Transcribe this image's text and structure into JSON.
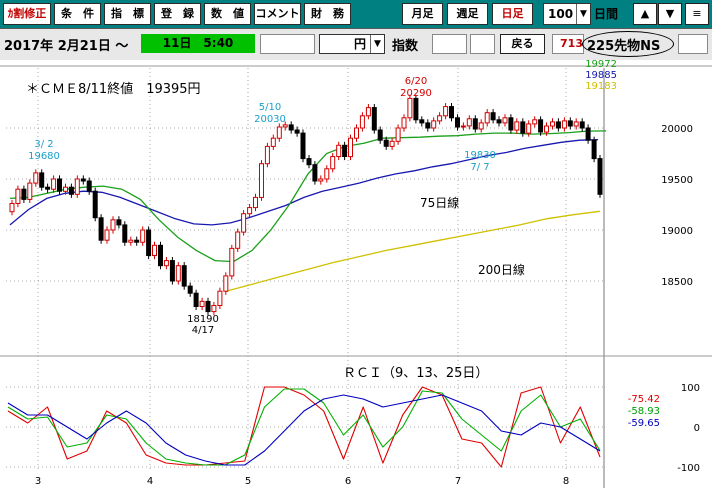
{
  "toolbar": {
    "buttons": [
      "ｶ割修正",
      "条　件",
      "指　標",
      "登　録",
      "数　値",
      "コメント",
      "財　務"
    ],
    "period_buttons": [
      "月足",
      "週足",
      "日足"
    ],
    "count_value": "100",
    "period_label": "日間",
    "up_icon": "▲",
    "down_icon": "▼",
    "menu_icon": "≡"
  },
  "filter": {
    "date": "2017年 2月21日 〜",
    "time": "11日　5:40",
    "currency": "円",
    "index_label": "指数",
    "back_button": "戻る",
    "code": "713",
    "instrument": "225先物NS"
  },
  "colors": {
    "accent_bar": "#008080",
    "time_bg": "#00c000",
    "candle_up": "#d40000",
    "candle_down": "#000000",
    "ma_short": "#1aa01a",
    "ma_75": "#1818b0",
    "ma_200": "#d0c000",
    "rci_9": "#e00000",
    "rci_13": "#00b000",
    "rci_25": "#0000c0"
  },
  "chart_data": {
    "type": "candlestick",
    "title": "＊ＣＭＥ8/11終値　19395円",
    "y_ticks": [
      20000,
      19500,
      19000,
      18500
    ],
    "ylim": [
      18180,
      20380
    ],
    "x_ticks": [
      "3",
      "4",
      "5",
      "6",
      "7",
      "8"
    ],
    "ma_values": [
      {
        "name": "short",
        "value": "19972"
      },
      {
        "name": "75",
        "value": "19885"
      },
      {
        "name": "200",
        "value": "19183"
      }
    ],
    "ma_labels": {
      "ma75": "75日線",
      "ma200": "200日線"
    },
    "annotations": [
      {
        "date": "3/ 2",
        "value": "19680",
        "pos": "above",
        "color": "cyan"
      },
      {
        "date": "5/10",
        "value": "20030",
        "pos": "above",
        "color": "cyan"
      },
      {
        "date": "6/20",
        "value": "20290",
        "pos": "above",
        "color": "red"
      },
      {
        "date": "7/ 7",
        "value": "19830",
        "pos": "below",
        "color": "cyan"
      },
      {
        "date": "4/17",
        "value": "18190",
        "pos": "below",
        "color": "black"
      }
    ],
    "series": [
      {
        "name": "short",
        "values": [
          19310,
          19320,
          19360,
          19400,
          19420,
          19430,
          19400,
          19300,
          19100,
          18930,
          18800,
          18700,
          18690,
          18800,
          19000,
          19250,
          19550,
          19750,
          19820,
          19850,
          19900,
          19905,
          19910,
          19920,
          19925,
          19940,
          19950,
          19950,
          19940,
          19945,
          19955,
          19970,
          19972
        ]
      },
      {
        "name": "75",
        "values": [
          19050,
          19200,
          19310,
          19360,
          19380,
          19370,
          19320,
          19250,
          19180,
          19110,
          19060,
          19050,
          19070,
          19120,
          19180,
          19240,
          19320,
          19380,
          19420,
          19460,
          19510,
          19550,
          19580,
          19620,
          19650,
          19690,
          19730,
          19760,
          19800,
          19830,
          19860,
          19880,
          19885
        ]
      },
      {
        "name": "200",
        "values": [
          18400,
          18470,
          18540,
          18610,
          18680,
          18740,
          18800,
          18850,
          18900,
          18950,
          19000,
          19050,
          19110,
          19150,
          19183
        ]
      }
    ],
    "candles": [
      19260,
      19400,
      19300,
      19460,
      19560,
      19420,
      19400,
      19500,
      19380,
      19420,
      19350,
      19500,
      19480,
      19380,
      19120,
      18900,
      19000,
      19100,
      19050,
      18880,
      18900,
      18880,
      19000,
      18750,
      18850,
      18650,
      18700,
      18500,
      18650,
      18450,
      18380,
      18250,
      18300,
      18200,
      18260,
      18400,
      18550,
      18820,
      18980,
      19160,
      19220,
      19320,
      19650,
      19820,
      19900,
      20010,
      20030,
      19980,
      19950,
      19700,
      19640,
      19480,
      19500,
      19600,
      19720,
      19830,
      19720,
      19900,
      20000,
      20120,
      20200,
      19980,
      19880,
      19820,
      19870,
      20000,
      20100,
      20290,
      20080,
      20050,
      20000,
      20070,
      20120,
      20210,
      20100,
      20010,
      20020,
      20090,
      19990,
      20050,
      20150,
      20080,
      20050,
      20100,
      19980,
      20060,
      19950,
      20040,
      20080,
      19960,
      20020,
      20060,
      20000,
      20070,
      20020,
      20060,
      20000,
      19880,
      19700,
      19350
    ],
    "rci": {
      "title": "ＲＣＩ（9、13、25日）",
      "y_ticks": [
        100,
        0,
        -100
      ],
      "ylim": [
        -100,
        100
      ],
      "values_text": [
        "-75.42",
        "-58.93",
        "-59.65"
      ],
      "series": [
        {
          "name": "9",
          "values": [
            40,
            10,
            50,
            -80,
            -60,
            40,
            10,
            -70,
            -90,
            -95,
            -95,
            -90,
            -85,
            100,
            100,
            80,
            40,
            -80,
            50,
            -90,
            30,
            100,
            80,
            -30,
            -40,
            -100,
            85,
            100,
            -40,
            50,
            -75
          ]
        },
        {
          "name": "13",
          "values": [
            50,
            20,
            25,
            -50,
            -40,
            30,
            20,
            -40,
            -80,
            -90,
            -95,
            -95,
            -70,
            50,
            95,
            95,
            60,
            -20,
            30,
            -50,
            0,
            90,
            85,
            20,
            -20,
            -60,
            40,
            80,
            0,
            20,
            -59
          ]
        },
        {
          "name": "25",
          "values": [
            60,
            30,
            30,
            0,
            -30,
            10,
            40,
            10,
            -40,
            -70,
            -85,
            -95,
            -95,
            -60,
            -10,
            40,
            70,
            80,
            70,
            50,
            60,
            70,
            80,
            60,
            40,
            -10,
            -20,
            10,
            0,
            -30,
            -60
          ]
        }
      ]
    }
  }
}
